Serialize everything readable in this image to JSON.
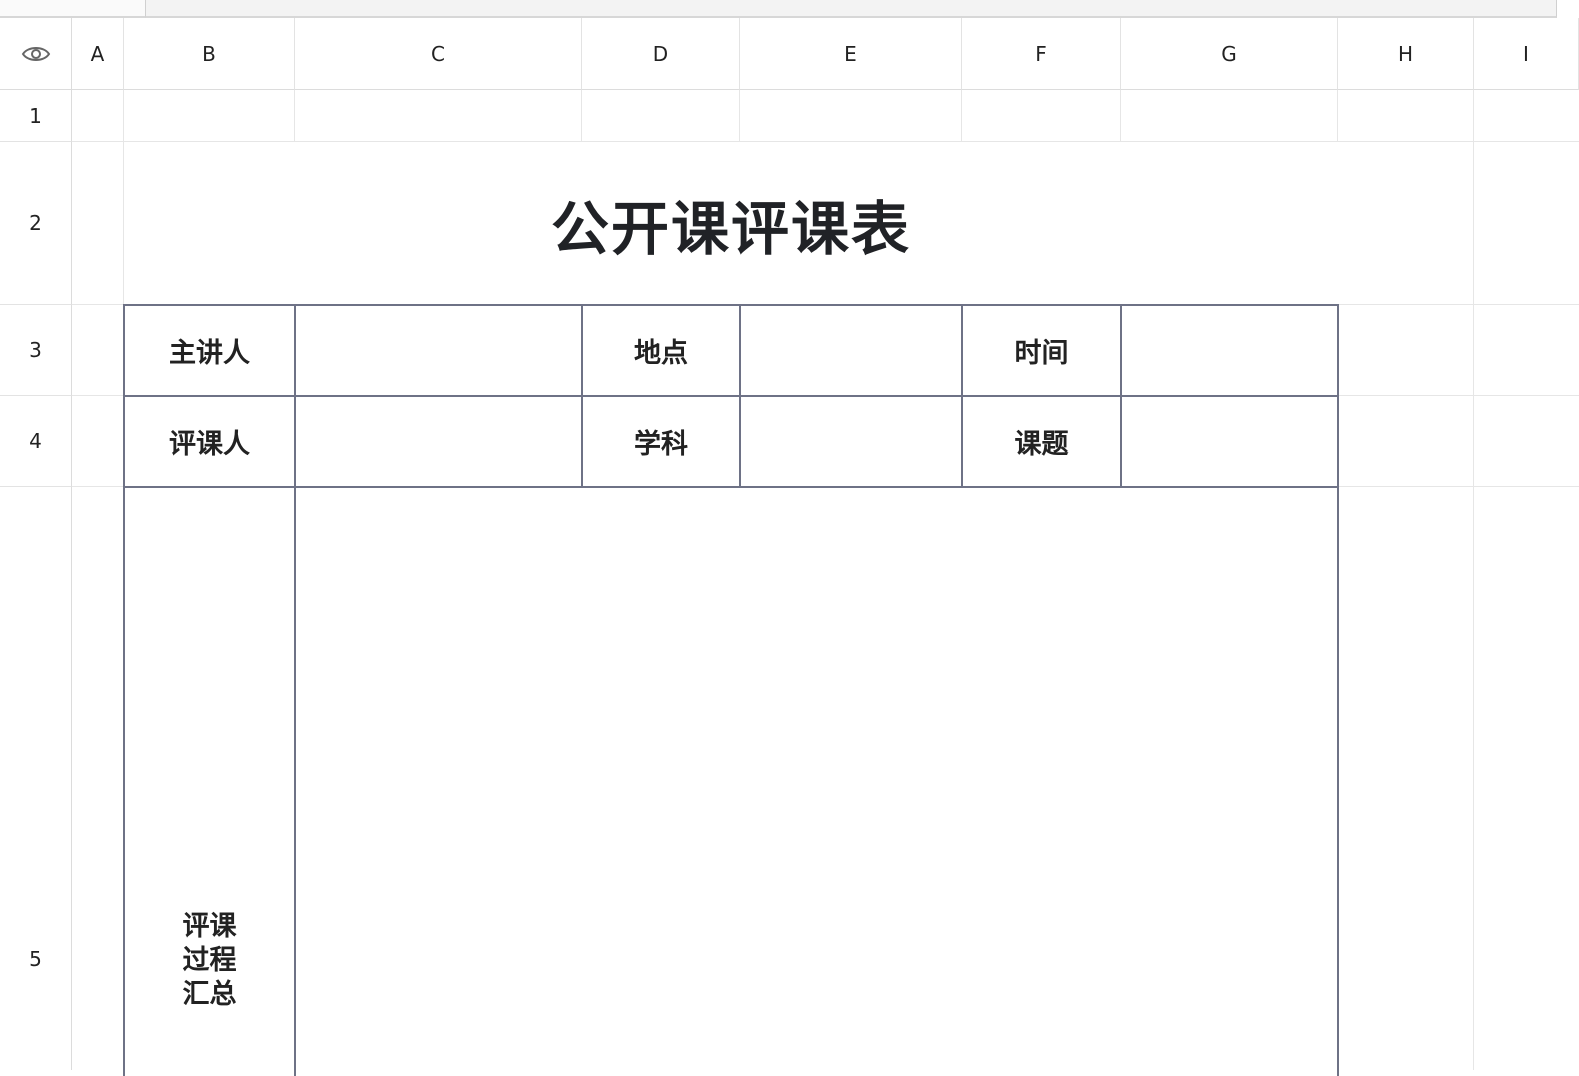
{
  "column_headers": [
    "A",
    "B",
    "C",
    "D",
    "E",
    "F",
    "G",
    "H",
    "I"
  ],
  "row_headers": [
    "1",
    "2",
    "3",
    "4",
    "5"
  ],
  "corner_icon": "eye-icon",
  "form": {
    "title": "公开课评课表",
    "row3": {
      "speaker_label": "主讲人",
      "speaker_value": "",
      "location_label": "地点",
      "location_value": "",
      "time_label": "时间",
      "time_value": ""
    },
    "row4": {
      "evaluator_label": "评课人",
      "evaluator_value": "",
      "subject_label": "学科",
      "subject_value": "",
      "topic_label": "课题",
      "topic_value": ""
    },
    "row5": {
      "summary_label_line1": "评课",
      "summary_label_line2": "过程",
      "summary_label_line3": "汇总",
      "summary_value": ""
    }
  }
}
